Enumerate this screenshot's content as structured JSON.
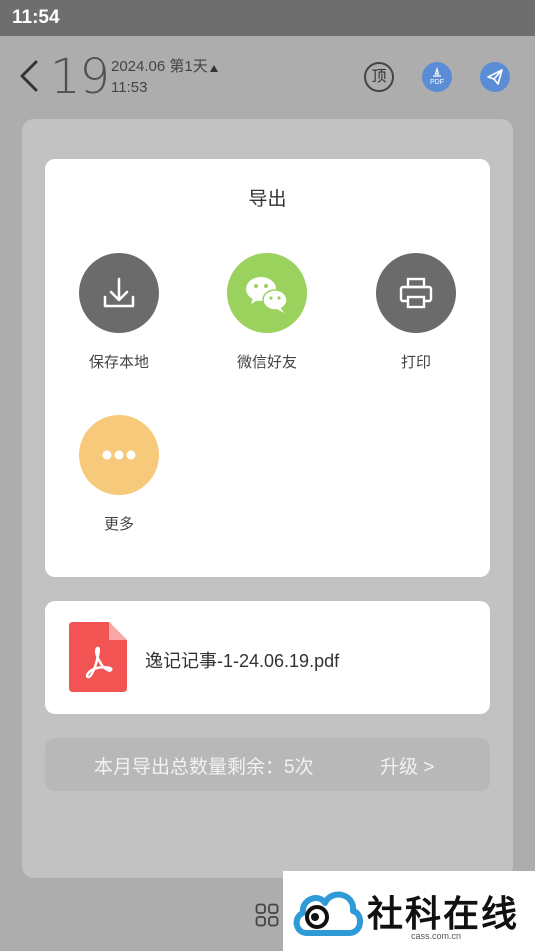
{
  "status_bar": {
    "time": "11:54"
  },
  "header": {
    "day": "19",
    "date_line": "2024.06 第1天",
    "time": "11:53",
    "top_icon_char": "顶",
    "pdf_icon_label": "PDF"
  },
  "export_dialog": {
    "title": "导出",
    "options": [
      {
        "label": "保存本地",
        "icon": "download-icon",
        "color": "#6b6b6b"
      },
      {
        "label": "微信好友",
        "icon": "wechat-icon",
        "color": "#9bd15d"
      },
      {
        "label": "打印",
        "icon": "printer-icon",
        "color": "#6b6b6b"
      },
      {
        "label": "更多",
        "icon": "more-icon",
        "color": "#f7c97a"
      }
    ]
  },
  "file": {
    "name": "逸记记事-1-24.06.19.pdf",
    "icon": "pdf-file-icon",
    "color": "#f25353"
  },
  "quota": {
    "text": "本月导出总数量剩余：5次",
    "upgrade": "升级 >"
  },
  "watermark": {
    "text": "社科在线",
    "url": "cass.com.cn"
  }
}
